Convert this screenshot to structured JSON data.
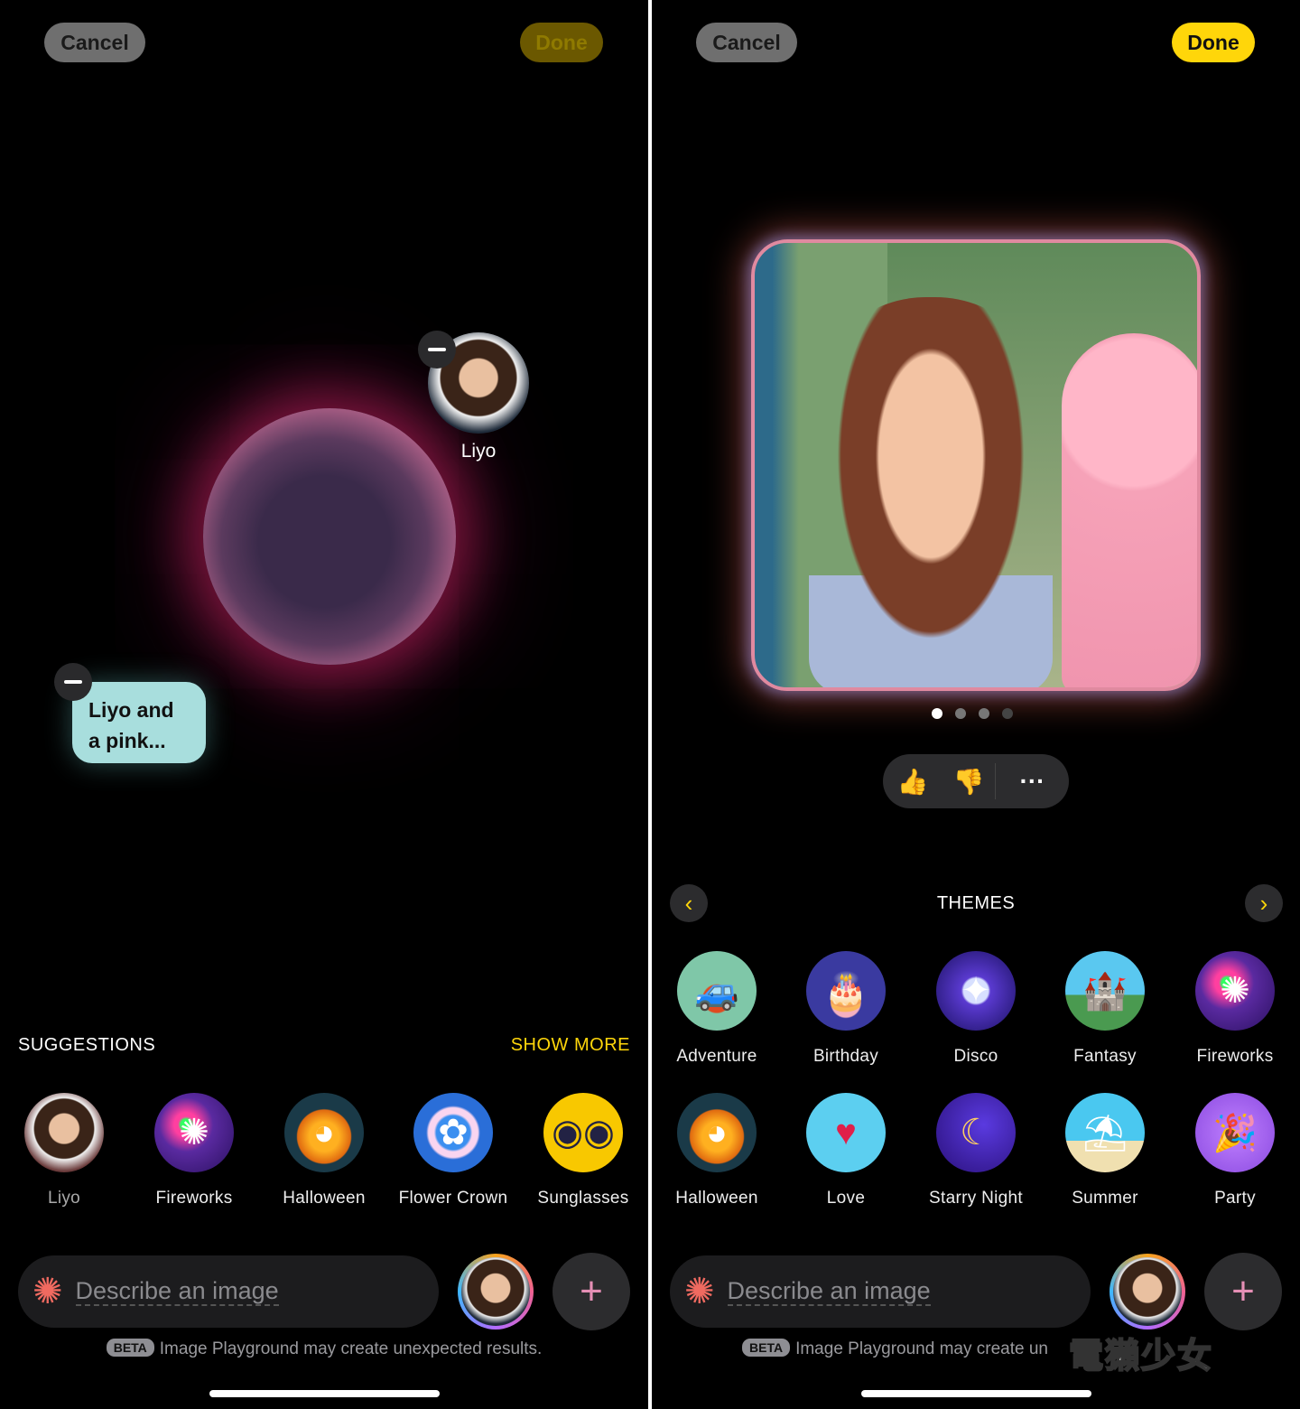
{
  "left": {
    "cancel_label": "Cancel",
    "done_label": "Done",
    "person": {
      "name": "Liyo"
    },
    "prompt_bubble": "Liyo and a pink...",
    "suggestions_title": "SUGGESTIONS",
    "show_more": "SHOW MORE",
    "suggestions": [
      {
        "label": "Liyo",
        "icon": "person-photo"
      },
      {
        "label": "Fireworks",
        "icon": "fireworks"
      },
      {
        "label": "Halloween",
        "icon": "jack-o-lantern"
      },
      {
        "label": "Flower Crown",
        "icon": "flower-crown"
      },
      {
        "label": "Sunglasses",
        "icon": "sunglasses"
      }
    ],
    "input_placeholder": "Describe an image",
    "beta_tag": "BETA",
    "beta_text": "Image Playground may create unexpected results."
  },
  "right": {
    "cancel_label": "Cancel",
    "done_label": "Done",
    "page_dots": {
      "count": 4,
      "active": 1
    },
    "themes_title": "THEMES",
    "themes": [
      {
        "label": "Adventure",
        "icon": "jeep"
      },
      {
        "label": "Birthday",
        "icon": "cake"
      },
      {
        "label": "Disco",
        "icon": "disco-ball"
      },
      {
        "label": "Fantasy",
        "icon": "castle-island"
      },
      {
        "label": "Fireworks",
        "icon": "fireworks"
      },
      {
        "label": "Halloween",
        "icon": "jack-o-lantern"
      },
      {
        "label": "Love",
        "icon": "heart-balloon"
      },
      {
        "label": "Starry Night",
        "icon": "moon-stars"
      },
      {
        "label": "Summer",
        "icon": "beach-umbrella"
      },
      {
        "label": "Party",
        "icon": "party-popper"
      }
    ],
    "input_placeholder": "Describe an image",
    "beta_tag": "BETA",
    "beta_text": "Image Playground may create un",
    "watermark": "電獺少女"
  },
  "colors": {
    "accent": "#ffd60a",
    "bubble": "#a8dedd"
  }
}
